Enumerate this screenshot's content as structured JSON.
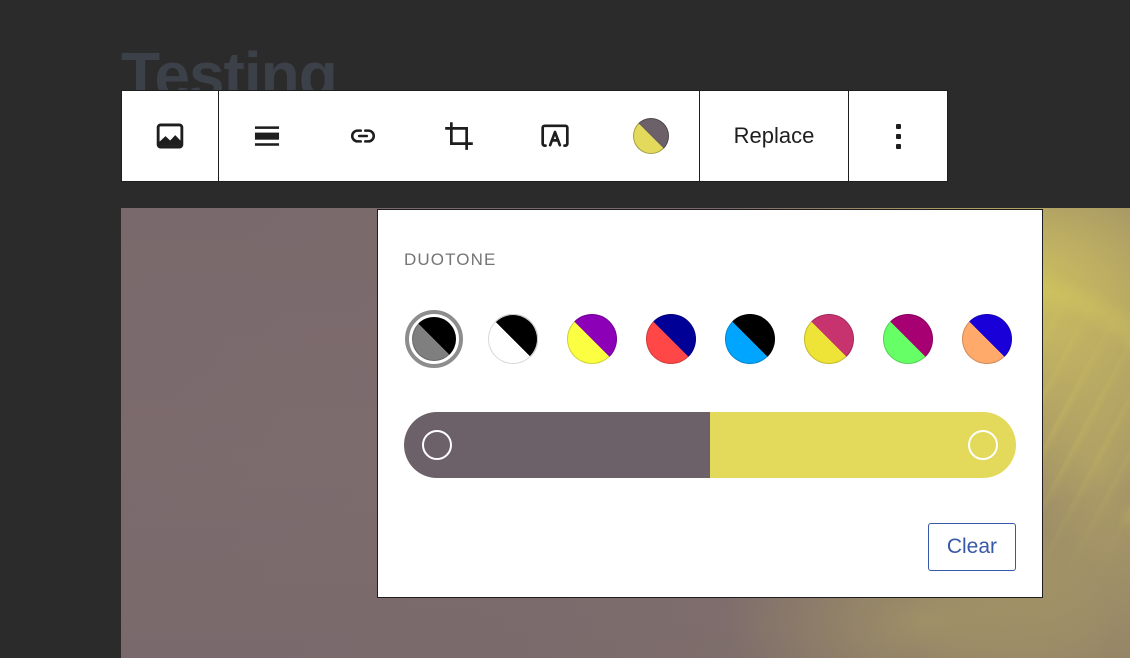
{
  "editor": {
    "background_color": "#2b2b2b",
    "heading_text": "Testing",
    "heading_color": "#3c4149"
  },
  "image_block": {
    "name": "duotone-image",
    "shadow_color": "#6c6169",
    "highlight_color": "#e3da5c"
  },
  "toolbar": {
    "block_type_label": "image-icon",
    "align_label": "align-center-icon",
    "link_label": "link-icon",
    "crop_label": "crop-icon",
    "text_over_image_label": "add-text-icon",
    "duotone_label": "duotone-icon",
    "replace_label": "Replace",
    "more_label": "more-options-icon",
    "duotone_chip": {
      "shadow": "#6c6169",
      "highlight": "#e3da5c"
    }
  },
  "popover": {
    "title": "DUOTONE",
    "presets": [
      {
        "name": "dark-grayscale",
        "shadow": "#000000",
        "highlight": "#7f7f7f",
        "selected": true,
        "light": false
      },
      {
        "name": "grayscale",
        "shadow": "#000000",
        "highlight": "#ffffff",
        "selected": false,
        "light": true
      },
      {
        "name": "purple-yellow",
        "shadow": "#8c00b7",
        "highlight": "#fcff41",
        "selected": false,
        "light": false
      },
      {
        "name": "blue-red",
        "shadow": "#000097",
        "highlight": "#ff4747",
        "selected": false,
        "light": false
      },
      {
        "name": "midnight",
        "shadow": "#000000",
        "highlight": "#00a5ff",
        "selected": false,
        "light": false
      },
      {
        "name": "magenta-yellow",
        "shadow": "#c7336e",
        "highlight": "#eee437",
        "selected": false,
        "light": false
      },
      {
        "name": "purple-green",
        "shadow": "#a60072",
        "highlight": "#67ff66",
        "selected": false,
        "light": false
      },
      {
        "name": "blue-orange",
        "shadow": "#1900d8",
        "highlight": "#ffa96b",
        "selected": false,
        "light": false
      }
    ],
    "slider": {
      "name": "duotone-color-stops",
      "stops": [
        {
          "name": "shadow-stop",
          "color": "#6c6169",
          "position_percent": 0
        },
        {
          "name": "highlight-stop",
          "color": "#e3da5c",
          "position_percent": 100
        }
      ],
      "split_percent": 50
    },
    "clear_label": "Clear",
    "clear_color": "#3858a8"
  }
}
